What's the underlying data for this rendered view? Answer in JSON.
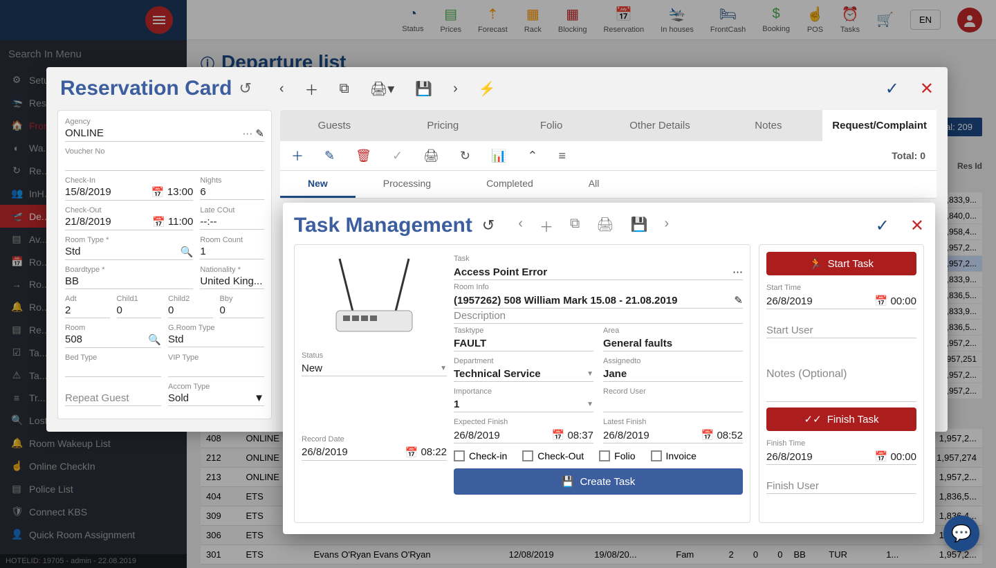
{
  "topnav": [
    {
      "label": "Status",
      "icon": "◔",
      "color": "icon-blue"
    },
    {
      "label": "Prices",
      "icon": "▤",
      "color": "icon-green"
    },
    {
      "label": "Forecast",
      "icon": "⇡",
      "color": "icon-orange"
    },
    {
      "label": "Rack",
      "icon": "▦",
      "color": "icon-orange"
    },
    {
      "label": "Blocking",
      "icon": "▦",
      "color": "icon-red"
    },
    {
      "label": "Reservation",
      "icon": "📅",
      "color": "icon-navy"
    },
    {
      "label": "In houses",
      "icon": "🛬",
      "color": "icon-red"
    },
    {
      "label": "FrontCash",
      "icon": "🛏",
      "color": "icon-blue"
    },
    {
      "label": "Booking",
      "icon": "$",
      "color": "icon-green"
    },
    {
      "label": "POS",
      "icon": "☝",
      "color": "icon-pink"
    },
    {
      "label": "Tasks",
      "icon": "⏰",
      "color": "icon-orange"
    }
  ],
  "cart_icon": "🛒",
  "lang": "EN",
  "sidebar": {
    "search": "Search In Menu",
    "items": [
      {
        "icon": "⚙",
        "label": "Setu..."
      },
      {
        "icon": "🛬",
        "label": "Rese..."
      },
      {
        "icon": "🏠",
        "label": "Fron...",
        "red": true
      },
      {
        "icon": "◐",
        "label": "Wa..."
      },
      {
        "icon": "↻",
        "label": "Re..."
      },
      {
        "icon": "👥",
        "label": "InH..."
      },
      {
        "icon": "🛫",
        "label": "De...",
        "active": true
      },
      {
        "icon": "▤",
        "label": "Av..."
      },
      {
        "icon": "📅",
        "label": "Ro..."
      },
      {
        "icon": "→",
        "label": "Ro..."
      },
      {
        "icon": "🔔",
        "label": "Ro..."
      },
      {
        "icon": "▤",
        "label": "Re..."
      },
      {
        "icon": "☑",
        "label": "Ta..."
      },
      {
        "icon": "⚠",
        "label": "Ta..."
      },
      {
        "icon": "≡",
        "label": "Tr..."
      },
      {
        "icon": "🔍",
        "label": "Lost and Found"
      },
      {
        "icon": "🔔",
        "label": "Room Wakeup List"
      },
      {
        "icon": "☝",
        "label": "Online CheckIn"
      },
      {
        "icon": "▤",
        "label": "Police List"
      },
      {
        "icon": "🛡",
        "label": "Connect KBS"
      },
      {
        "icon": "👤",
        "label": "Quick Room Assignment"
      }
    ],
    "footer": "HOTELID: 19705 - admin - 22.08.2019"
  },
  "page": {
    "title": "Departure list",
    "total_label": "tal: 209",
    "resid_header": "Res Id",
    "resids": [
      "1,833,9...",
      "1,840,0...",
      "1,958,4...",
      "1,957,2...",
      "1,957,2...",
      "1,833,9...",
      "1,836,5...",
      "1,833,9...",
      "1,836,5...",
      "1,957,2...",
      "1,957,251",
      "1,957,2...",
      "1,957,2..."
    ],
    "resid_highlight_index": 4
  },
  "bgtable": [
    {
      "room": "408",
      "agency": "ONLINE"
    },
    {
      "room": "212",
      "agency": "ONLINE"
    },
    {
      "room": "213",
      "agency": "ONLINE"
    },
    {
      "room": "404",
      "agency": "ETS"
    },
    {
      "room": "309",
      "agency": "ETS"
    },
    {
      "room": "306",
      "agency": "ETS"
    },
    {
      "room": "301",
      "agency": "ETS",
      "guest": "Evans O'Ryan Evans O'Ryan",
      "cin": "12/08/2019",
      "cout": "19/08/20...",
      "type": "Fam",
      "a": "2",
      "c": "0",
      "d": "0",
      "bb": "BB",
      "nat": "TUR",
      "x": "1..."
    }
  ],
  "bgtable_right": [
    "1,957,2...",
    "1,957,274",
    "1,957,2...",
    "1,836,5...",
    "1,836,4...",
    "1,957,2...",
    "1,957,2..."
  ],
  "res": {
    "title": "Reservation Card",
    "agency_label": "Agency",
    "agency": "ONLINE",
    "voucher_label": "Voucher No",
    "checkin_label": "Check-In",
    "checkin": "15/8/2019",
    "checkin_time": "13:00",
    "nights_label": "Nights",
    "nights": "6",
    "checkout_label": "Check-Out",
    "checkout": "21/8/2019",
    "checkout_time": "11:00",
    "latecout_label": "Late COut",
    "latecout": "--:--",
    "roomtype_label": "Room Type *",
    "roomtype": "Std",
    "roomcount_label": "Room Count",
    "roomcount": "1",
    "boardtype_label": "Boardtype *",
    "boardtype": "BB",
    "nationality_label": "Nationality *",
    "nationality": "United King...",
    "adt_label": "Adt",
    "adt": "2",
    "child1_label": "Child1",
    "child1": "0",
    "child2_label": "Child2",
    "child2": "0",
    "bby_label": "Bby",
    "bby": "0",
    "room_label": "Room",
    "room": "508",
    "groomtype_label": "G.Room Type",
    "groomtype": "Std",
    "bedtype_label": "Bed Type",
    "viptype_label": "VIP Type",
    "acctype_label": "Accom Type",
    "acctype": "Sold",
    "repeat_label": "Repeat Guest",
    "tabs": [
      "Guests",
      "Pricing",
      "Folio",
      "Other Details",
      "Notes",
      "Request/Complaint"
    ],
    "active_tab": 5,
    "toolbar_total": "Total: 0",
    "subtabs": [
      "New",
      "Processing",
      "Completed",
      "All"
    ],
    "active_subtab": 0
  },
  "task": {
    "title": "Task Management",
    "task_label": "Task",
    "task": "Access Point Error",
    "roominfo_label": "Room Info",
    "roominfo": "(1957262) 508 William Mark 15.08 - 21.08.2019",
    "description_label": "Description",
    "tasktype_label": "Tasktype",
    "tasktype": "FAULT",
    "area_label": "Area",
    "area": "General faults",
    "department_label": "Department",
    "department": "Technical Service",
    "assignedto_label": "Assignedto",
    "assignedto": "Jane",
    "importance_label": "Importance",
    "importance": "1",
    "recorduser_label": "Record User",
    "expectedfinish_label": "Expected Finish",
    "expectedfinish_date": "26/8/2019",
    "expectedfinish_time": "08:37",
    "latestfinish_label": "Latest Finish",
    "latestfinish_date": "26/8/2019",
    "latestfinish_time": "08:52",
    "status_label": "Status",
    "status": "New",
    "recorddate_label": "Record Date",
    "recorddate": "26/8/2019",
    "recorddate_time": "08:22",
    "cb_checkin": "Check-in",
    "cb_checkout": "Check-Out",
    "cb_folio": "Folio",
    "cb_invoice": "Invoice",
    "create_btn": "Create Task",
    "start_btn": "Start Task",
    "starttime_label": "Start Time",
    "starttime_date": "26/8/2019",
    "starttime_time": "00:00",
    "startuser_label": "Start User",
    "notes_label": "Notes (Optional)",
    "finish_btn": "Finish Task",
    "finishtime_label": "Finish Time",
    "finishtime_date": "26/8/2019",
    "finishtime_time": "00:00",
    "finishuser_label": "Finish User"
  }
}
